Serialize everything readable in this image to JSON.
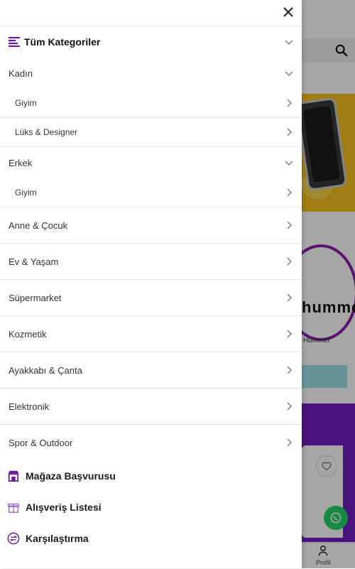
{
  "drawer": {
    "header": {
      "label": "Tüm Kategoriler"
    },
    "sections": [
      {
        "label": "Kadın",
        "children": [
          "Giyim",
          "Lüks & Designer"
        ]
      },
      {
        "label": "Erkek",
        "children": [
          "Giyim"
        ]
      }
    ],
    "categories": [
      "Anne & Çocuk",
      "Ev & Yaşam",
      "Süpermarket",
      "Kozmetik",
      "Ayakkabı & Çanta",
      "Elektronik",
      "Spor & Outdoor"
    ],
    "footer_links": [
      {
        "label": "Mağaza Başvurusu",
        "icon": "store-icon"
      },
      {
        "label": "Alışveriş Listesi",
        "icon": "gift-box-icon"
      },
      {
        "label": "Karşılaştırma",
        "icon": "compare-arrows-icon"
      }
    ]
  },
  "background": {
    "brand_logo_text": "hummel",
    "brand_label": "Hummel",
    "bottom_nav_profile": "Profil"
  },
  "colors": {
    "accent": "#6a1b9a",
    "overlay": "rgba(0,0,0,0.35)"
  }
}
